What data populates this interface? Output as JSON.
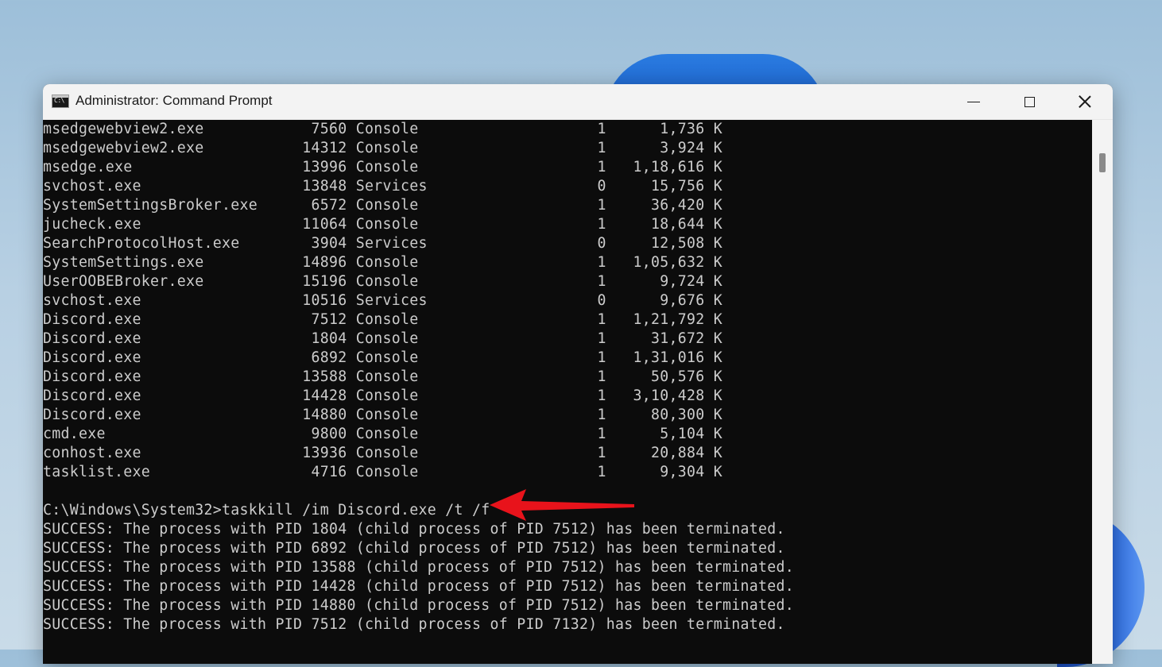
{
  "window": {
    "title": "Administrator: Command Prompt",
    "icon": "cmd-icon",
    "icon_text": "C:\\",
    "controls": [
      "minimize-icon",
      "maximize-icon",
      "close-icon"
    ]
  },
  "console": {
    "lines": [
      "msedgewebview2.exe            7560 Console                    1      1,736 K",
      "msedgewebview2.exe           14312 Console                    1      3,924 K",
      "msedge.exe                   13996 Console                    1   1,18,616 K",
      "svchost.exe                  13848 Services                   0     15,756 K",
      "SystemSettingsBroker.exe      6572 Console                    1     36,420 K",
      "jucheck.exe                  11064 Console                    1     18,644 K",
      "SearchProtocolHost.exe        3904 Services                   0     12,508 K",
      "SystemSettings.exe           14896 Console                    1   1,05,632 K",
      "UserOOBEBroker.exe           15196 Console                    1      9,724 K",
      "svchost.exe                  10516 Services                   0      9,676 K",
      "Discord.exe                   7512 Console                    1   1,21,792 K",
      "Discord.exe                   1804 Console                    1     31,672 K",
      "Discord.exe                   6892 Console                    1   1,31,016 K",
      "Discord.exe                  13588 Console                    1     50,576 K",
      "Discord.exe                  14428 Console                    1   3,10,428 K",
      "Discord.exe                  14880 Console                    1     80,300 K",
      "cmd.exe                       9800 Console                    1      5,104 K",
      "conhost.exe                  13936 Console                    1     20,884 K",
      "tasklist.exe                  4716 Console                    1      9,304 K",
      "",
      "C:\\Windows\\System32>taskkill /im Discord.exe /t /f",
      "SUCCESS: The process with PID 1804 (child process of PID 7512) has been terminated.",
      "SUCCESS: The process with PID 6892 (child process of PID 7512) has been terminated.",
      "SUCCESS: The process with PID 13588 (child process of PID 7512) has been terminated.",
      "SUCCESS: The process with PID 14428 (child process of PID 7512) has been terminated.",
      "SUCCESS: The process with PID 14880 (child process of PID 7512) has been terminated.",
      "SUCCESS: The process with PID 7512 (child process of PID 7132) has been terminated."
    ]
  },
  "annotation": {
    "icon": "red-arrow-icon",
    "color": "#e8131b",
    "points_to": "taskkill command"
  },
  "colors": {
    "console_bg": "#0c0c0c",
    "console_fg": "#cccccc",
    "titlebar_bg": "#f3f3f3"
  }
}
